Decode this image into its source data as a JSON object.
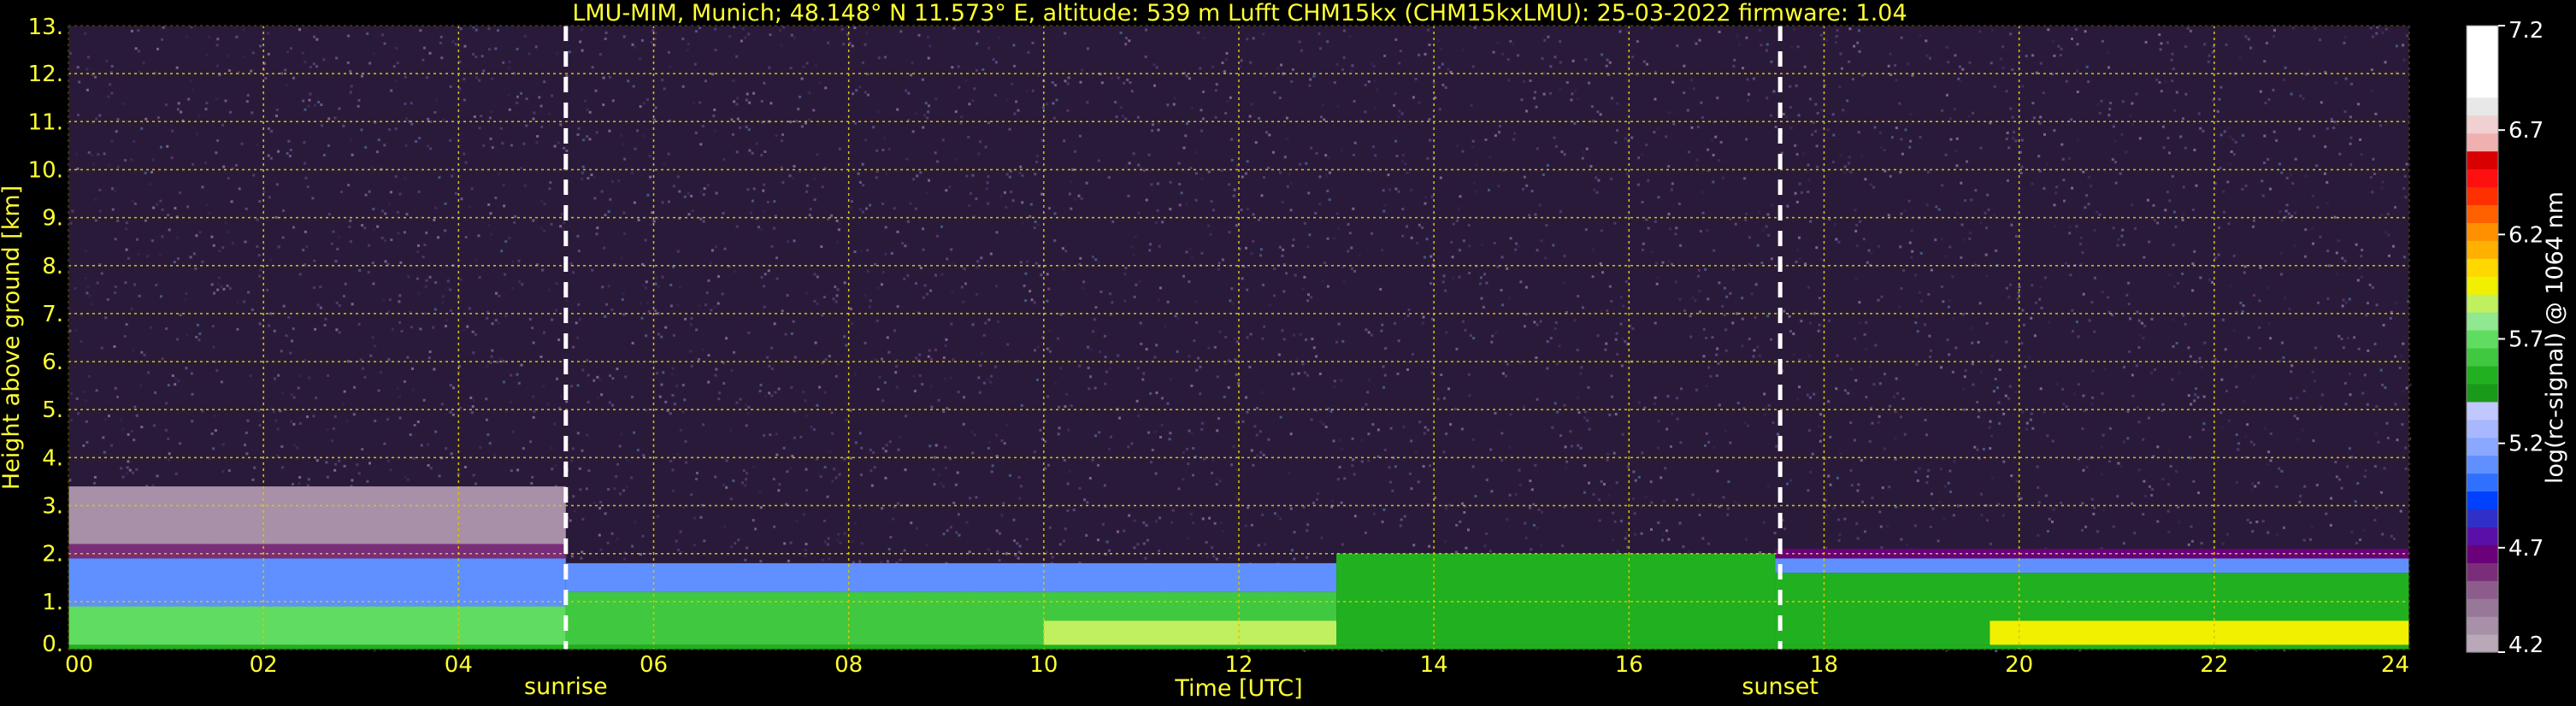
{
  "chart_data": {
    "type": "heatmap",
    "title": "LMU-MIM, Munich; 48.148° N 11.573° E, altitude: 539 m    Lufft CHM15kx (CHM15kxLMU): 25-03-2022    firmware: 1.04",
    "xlabel": "Time [UTC]",
    "ylabel": "Height above ground [km]",
    "xlim": [
      0,
      24
    ],
    "ylim": [
      0,
      13
    ],
    "x_ticks": [
      "00",
      "02",
      "04",
      "06",
      "08",
      "10",
      "12",
      "14",
      "16",
      "18",
      "20",
      "22",
      "24"
    ],
    "y_ticks": [
      "0.",
      "1.",
      "2.",
      "3.",
      "4.",
      "5.",
      "6.",
      "7.",
      "8.",
      "9.",
      "10.",
      "11.",
      "12.",
      "13."
    ],
    "grid": true,
    "markers": [
      {
        "label": "sunrise",
        "x": 5.1
      },
      {
        "label": "sunset",
        "x": 17.55
      }
    ],
    "colorbar": {
      "label": "log(rc-signal) @ 1064 nm",
      "range": [
        4.2,
        7.2
      ],
      "ticks": [
        "4.2",
        "4.7",
        "5.2",
        "5.7",
        "6.2",
        "6.7",
        "7.2"
      ],
      "colors": [
        "#b8a8b8",
        "#a890a8",
        "#987898",
        "#8c5c8c",
        "#7a2e7a",
        "#6a007a",
        "#5a10a8",
        "#3030c8",
        "#0040ff",
        "#3070ff",
        "#6090ff",
        "#8aa8ff",
        "#a8b8ff",
        "#c0c8ff",
        "#1a9a1a",
        "#20b020",
        "#40c840",
        "#60dc60",
        "#90e890",
        "#c0f060",
        "#f0f000",
        "#ffd800",
        "#ffb000",
        "#ff9000",
        "#ff6000",
        "#ff3000",
        "#ff1010",
        "#d80000",
        "#f0b0b0",
        "#f0d0d0",
        "#e8e8e8",
        "#ffffff",
        "#ffffff",
        "#ffffff",
        "#ffffff"
      ]
    },
    "layers": [
      {
        "t0": 0,
        "t1": 24,
        "h0": 0.0,
        "h1": 0.1,
        "color": "#20b020",
        "level": 5.3
      },
      {
        "t0": 0,
        "t1": 5.1,
        "h0": 0.1,
        "h1": 0.9,
        "color": "#60dc60",
        "level": 5.4
      },
      {
        "t0": 0,
        "t1": 5.1,
        "h0": 0.9,
        "h1": 1.9,
        "color": "#6090ff",
        "level": 5.0
      },
      {
        "t0": 0,
        "t1": 5.1,
        "h0": 1.9,
        "h1": 2.2,
        "color": "#7a2e7a",
        "level": 4.6
      },
      {
        "t0": 0,
        "t1": 5.1,
        "h0": 2.2,
        "h1": 3.4,
        "color": "#a890a8",
        "level": 4.4
      },
      {
        "t0": 5.1,
        "t1": 13.0,
        "h0": 0.1,
        "h1": 1.2,
        "color": "#40c840",
        "level": 5.4
      },
      {
        "t0": 5.1,
        "t1": 13.0,
        "h0": 1.2,
        "h1": 1.8,
        "color": "#6090ff",
        "level": 5.0
      },
      {
        "t0": 13.0,
        "t1": 17.5,
        "h0": 0.1,
        "h1": 2.0,
        "color": "#20b020",
        "level": 5.4
      },
      {
        "t0": 10.0,
        "t1": 13.0,
        "h0": 0.1,
        "h1": 0.6,
        "color": "#c0f060",
        "level": 5.6
      },
      {
        "t0": 17.5,
        "t1": 24,
        "h0": 0.1,
        "h1": 1.6,
        "color": "#20b020",
        "level": 5.4
      },
      {
        "t0": 17.5,
        "t1": 24,
        "h0": 1.6,
        "h1": 1.9,
        "color": "#6090ff",
        "level": 5.0
      },
      {
        "t0": 17.5,
        "t1": 24,
        "h0": 1.9,
        "h1": 2.1,
        "color": "#6a007a",
        "level": 4.7
      },
      {
        "t0": 19.7,
        "t1": 24,
        "h0": 0.1,
        "h1": 0.6,
        "color": "#f0f000",
        "level": 5.7
      }
    ],
    "noise_background": "#2a1a3a"
  }
}
